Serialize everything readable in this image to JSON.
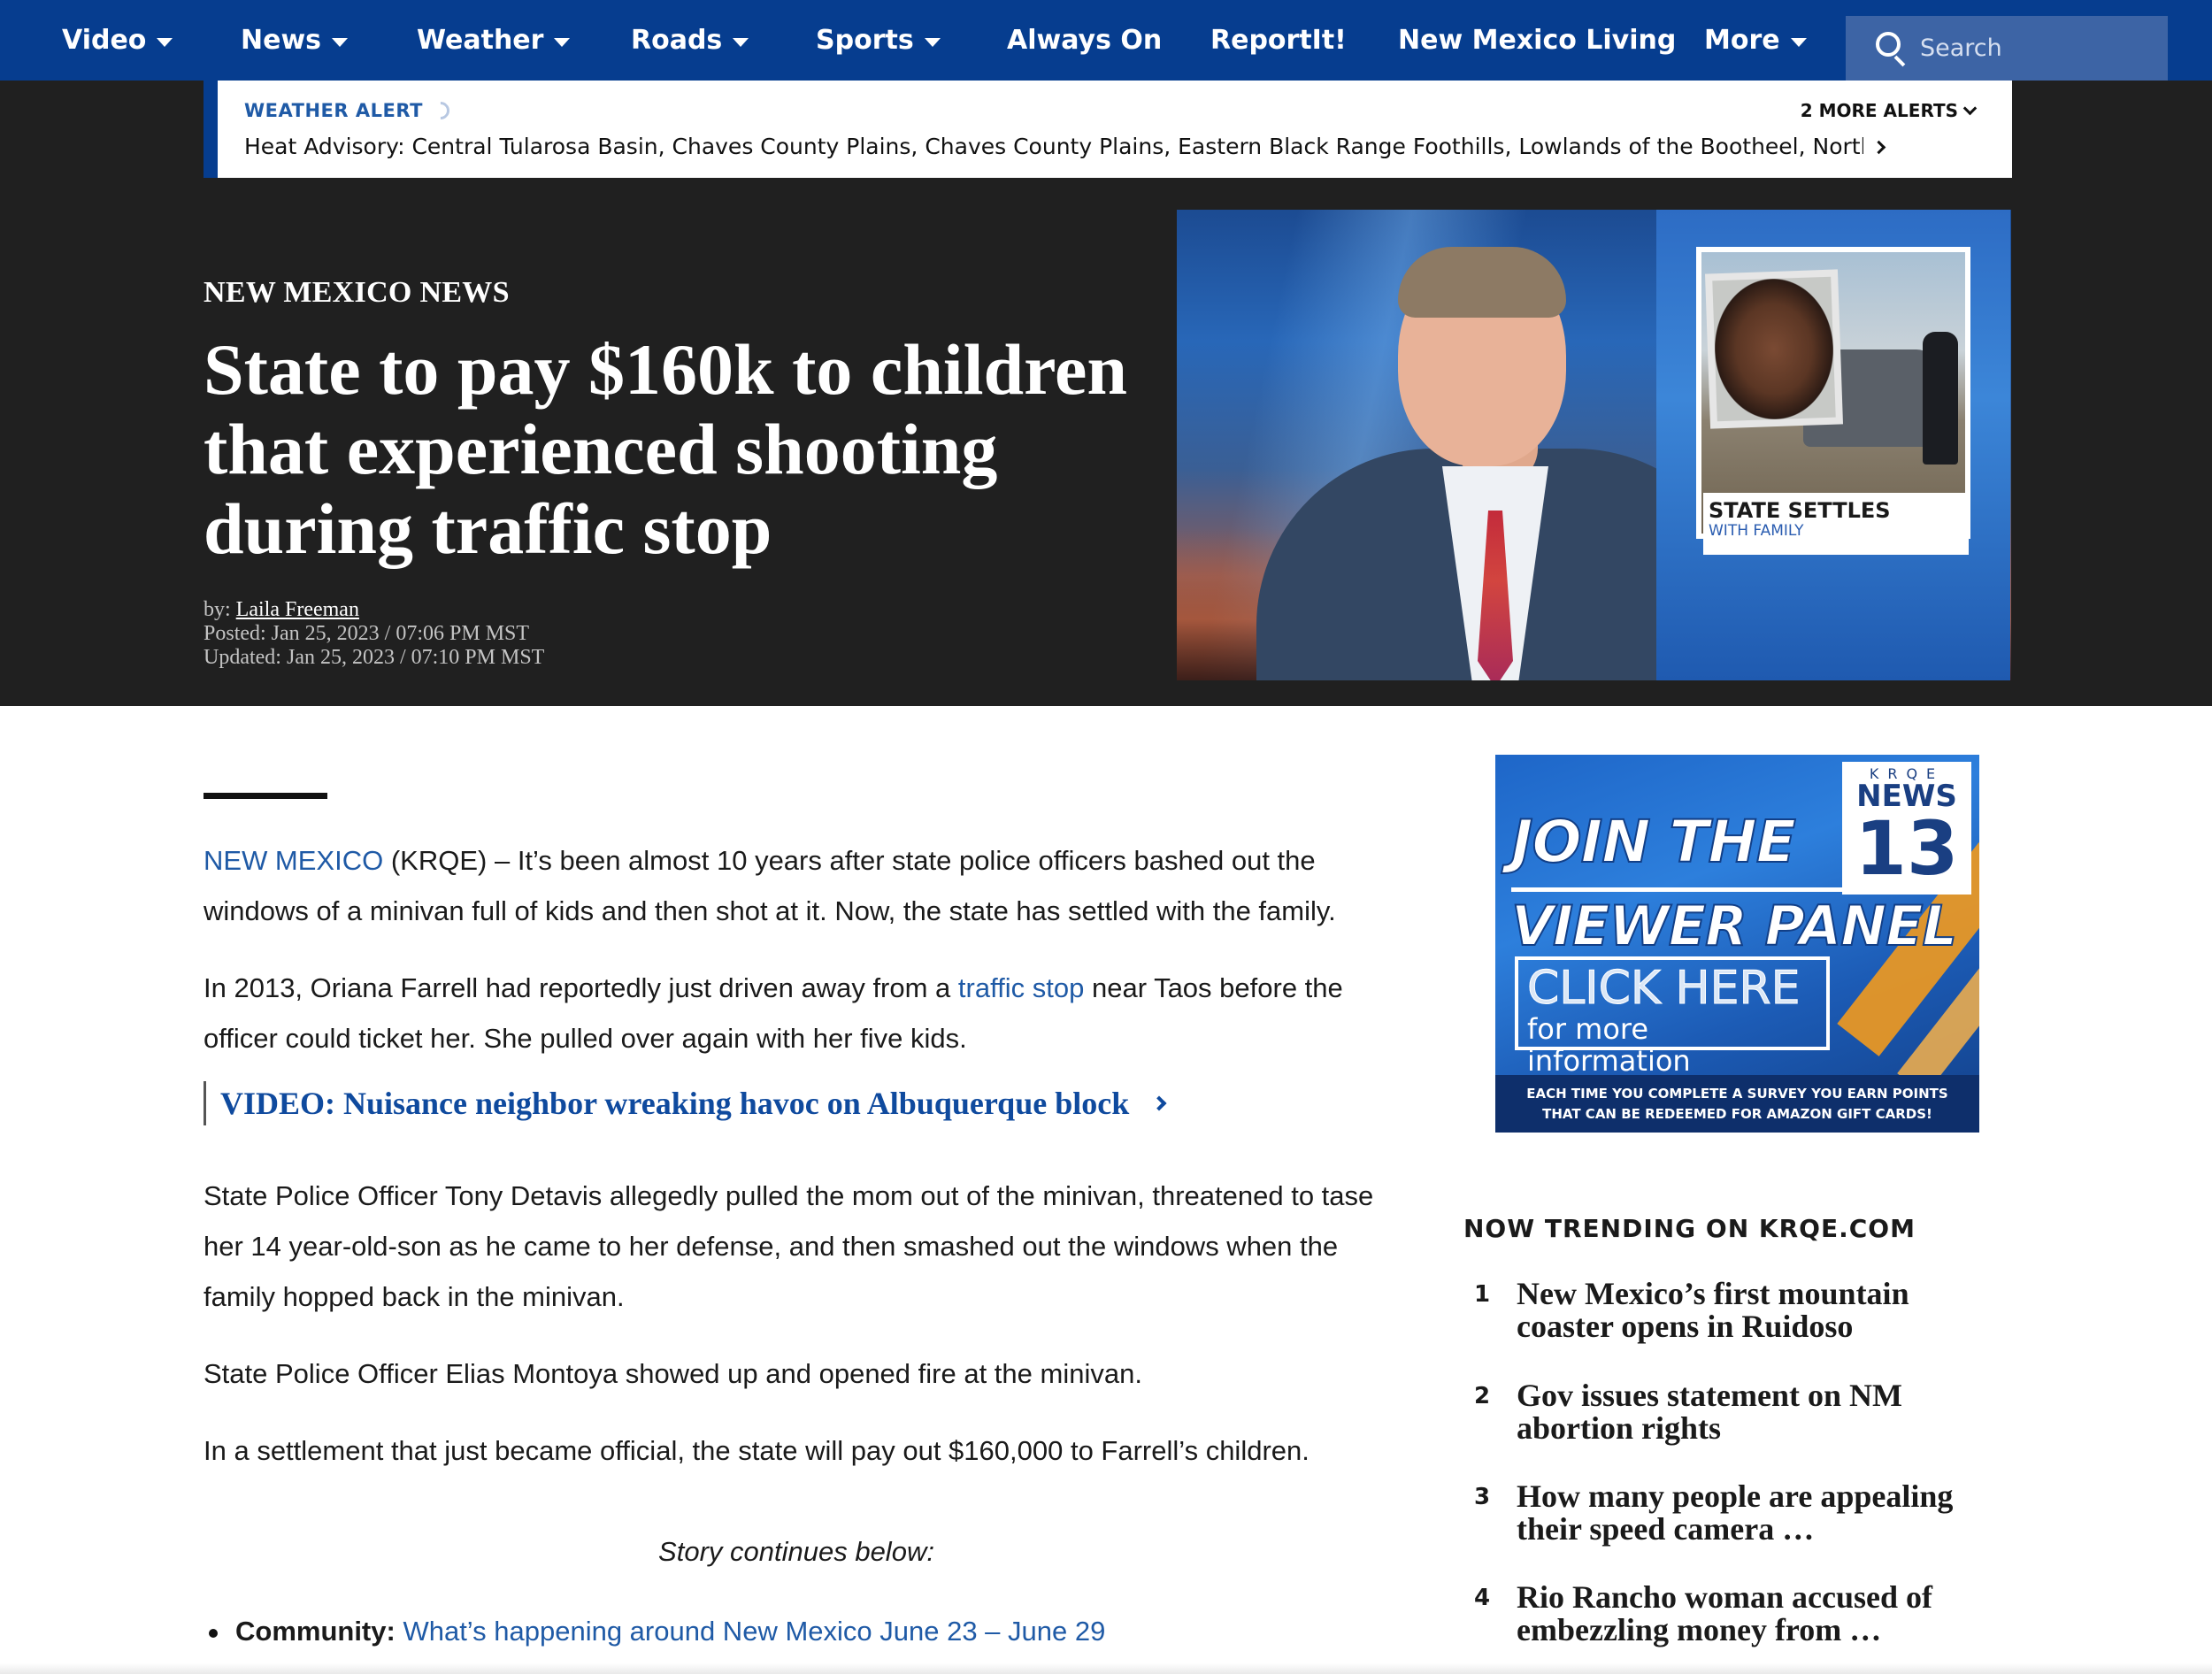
{
  "nav": {
    "items": [
      {
        "label": "Video",
        "dropdown": true
      },
      {
        "label": "News",
        "dropdown": true
      },
      {
        "label": "Weather",
        "dropdown": true
      },
      {
        "label": "Roads",
        "dropdown": true
      },
      {
        "label": "Sports",
        "dropdown": true
      },
      {
        "label": "Always On",
        "dropdown": false
      },
      {
        "label": "ReportIt!",
        "dropdown": false
      },
      {
        "label": "New Mexico Living",
        "dropdown": false
      },
      {
        "label": "More",
        "dropdown": true
      }
    ],
    "search_placeholder": "Search"
  },
  "alert": {
    "label": "WEATHER ALERT",
    "more": "2 MORE ALERTS",
    "text": "Heat Advisory: Central Tularosa Basin, Chaves County Plains, Chaves County Plains, Eastern Black Range Foothills, Lowlands of the Bootheel, Northern …"
  },
  "article": {
    "section": "NEW MEXICO NEWS",
    "headline": "State to pay $160k to children that experienced shooting during traffic stop",
    "by_prefix": "by:",
    "author": "Laila Freeman",
    "posted": "Posted: Jan 25, 2023 / 07:06 PM MST",
    "updated": "Updated: Jan 25, 2023 / 07:10 PM MST",
    "image_caption_1": "STATE SETTLES",
    "image_caption_2": "WITH FAMILY",
    "p1_link": "NEW MEXICO",
    "p1_text": " (KRQE) – It’s been almost 10 years after state police officers bashed out the windows of a minivan full of kids and then shot at it. Now, the state has settled with the family.",
    "p2_before": "In 2013, Oriana Farrell had reportedly just driven away from a ",
    "p2_link": "traffic stop",
    "p2_after": " near Taos before the officer could ticket her. She pulled over again with her five kids.",
    "video_link": "VIDEO: Nuisance neighbor wreaking havoc on Albuquerque block",
    "p3": "State Police Officer Tony Detavis allegedly pulled the mom out of the minivan, threatened to tase her 14 year-old-son as he came to her defense, and then smashed out the windows when the family hopped back in the minivan.",
    "p4": "State Police Officer Elias Montoya showed up and opened fire at the minivan.",
    "p5": "In a settlement that just became official, the state will pay out $160,000 to Farrell’s children.",
    "continues": "Story continues below:",
    "bullet_label": "Community:",
    "bullet_link": "What’s happening around New Mexico June 23 – June 29"
  },
  "ad": {
    "logo_top": "KRQE",
    "logo_news": "NEWS",
    "logo_num": "13",
    "line1": "JOIN THE",
    "line2": "VIEWER PANEL",
    "click": "CLICK HERE",
    "click_sub": "for more information",
    "foot1": "EACH TIME YOU COMPLETE A SURVEY YOU EARN POINTS",
    "foot2": "THAT CAN BE REDEEMED FOR AMAZON GIFT CARDS!"
  },
  "trending": {
    "title": "NOW TRENDING ON KRQE.COM",
    "items": [
      {
        "num": "1",
        "text": "New Mexico’s first mountain coaster opens in Ruidoso"
      },
      {
        "num": "2",
        "text": "Gov issues statement on NM abortion rights"
      },
      {
        "num": "3",
        "text": "How many people are appealing their speed camera …"
      },
      {
        "num": "4",
        "text": "Rio Rancho woman accused of embezzling money from …"
      }
    ]
  },
  "colors": {
    "nav_bg": "#063d8f",
    "hero_bg": "#202020",
    "link": "#1f5aa6"
  }
}
